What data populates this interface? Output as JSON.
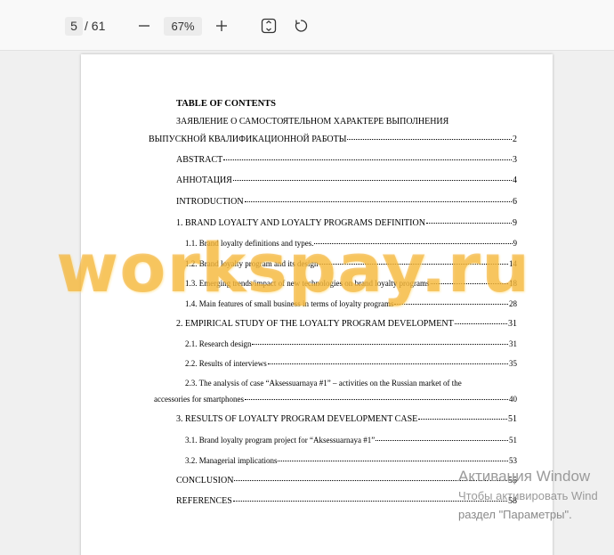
{
  "toolbar": {
    "current_page": "5",
    "total_pages": "/ 61",
    "zoom": "67%",
    "zoom_out_icon": "minus-icon",
    "zoom_in_icon": "plus-icon",
    "fit_icon": "fit-page-icon",
    "rotate_icon": "rotate-icon"
  },
  "document": {
    "toc_title": "TABLE OF CONTENTS",
    "declaration_line1": "ЗАЯВЛЕНИЕ О САМОСТОЯТЕЛЬНОМ ХАРАКТЕРЕ ВЫПОЛНЕНИЯ",
    "entries": [
      {
        "label": "ВЫПУСКНОЙ КВАЛИФИКАЦИОННОЙ РАБОТЫ",
        "page": "2"
      },
      {
        "label": "ABSTRACT",
        "page": "3"
      },
      {
        "label": "АННОТАЦИЯ",
        "page": "4"
      },
      {
        "label": "INTRODUCTION",
        "page": "6"
      },
      {
        "label": "1. BRAND LOYALTY AND LOYALTY PROGRAMS DEFINITION",
        "page": "9"
      },
      {
        "label": "1.1. Brand loyalty definitions and types.",
        "page": "9"
      },
      {
        "label": "1.2. Brand loyalty program and its design",
        "page": "14"
      },
      {
        "label": "1.3. Emerging trends/impact of new technologies on brand loyalty programs",
        "page": "18"
      },
      {
        "label": "1.4. Main features of small business in terms of loyalty programs",
        "page": "28"
      },
      {
        "label": "2. EMPIRICAL STUDY OF THE LOYALTY PROGRAM DEVELOPMENT",
        "page": "31"
      },
      {
        "label": "2.1. Research design",
        "page": "31"
      },
      {
        "label": "2.2. Results of interviews",
        "page": "35"
      },
      {
        "label": "accessories for smartphones",
        "page": "40"
      },
      {
        "label": "3. RESULTS OF LOYALTY PROGRAM DEVELOPMENT CASE",
        "page": "51"
      },
      {
        "label": "3.1. Brand loyalty program project for “Aksessuarnaya #1”",
        "page": "51"
      },
      {
        "label": "3.2. Managerial implications",
        "page": "53"
      },
      {
        "label": "CONCLUSION",
        "page": "55"
      },
      {
        "label": "REFERENCES",
        "page": "58"
      }
    ],
    "case_line1": "2.3. The analysis of case “Aksessuarnaya #1” – activities on the Russian market of the"
  },
  "watermark": "workspay.ru",
  "activation": {
    "line1": "Активация Window",
    "line2": "Чтобы активировать Wind",
    "line3": "раздел \"Параметры\"."
  }
}
